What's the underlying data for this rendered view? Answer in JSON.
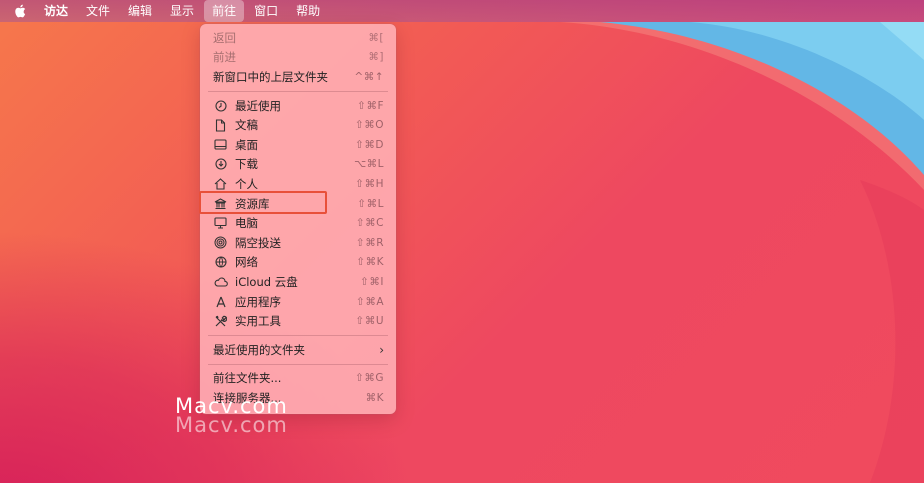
{
  "menubar": {
    "apple": "apple-logo",
    "items": [
      "访达",
      "文件",
      "编辑",
      "显示",
      "前往",
      "窗口",
      "帮助"
    ],
    "active": "前往"
  },
  "menu": {
    "nav": [
      {
        "label": "返回",
        "shortcut": "⌘[",
        "disabled": true
      },
      {
        "label": "前进",
        "shortcut": "⌘]",
        "disabled": true
      },
      {
        "label": "新窗口中的上层文件夹",
        "shortcut": "^⌘↑",
        "disabled": false
      }
    ],
    "places": [
      {
        "icon": "clock-icon",
        "label": "最近使用",
        "shortcut": "⇧⌘F"
      },
      {
        "icon": "document-icon",
        "label": "文稿",
        "shortcut": "⇧⌘O"
      },
      {
        "icon": "desktop-icon",
        "label": "桌面",
        "shortcut": "⇧⌘D"
      },
      {
        "icon": "download-icon",
        "label": "下载",
        "shortcut": "⌥⌘L"
      },
      {
        "icon": "home-icon",
        "label": "个人",
        "shortcut": "⇧⌘H"
      },
      {
        "icon": "library-icon",
        "label": "资源库",
        "shortcut": "⇧⌘L"
      },
      {
        "icon": "computer-icon",
        "label": "电脑",
        "shortcut": "⇧⌘C"
      },
      {
        "icon": "airdrop-icon",
        "label": "隔空投送",
        "shortcut": "⇧⌘R"
      },
      {
        "icon": "network-icon",
        "label": "网络",
        "shortcut": "⇧⌘K"
      },
      {
        "icon": "cloud-icon",
        "label": "iCloud 云盘",
        "shortcut": "⇧⌘I"
      },
      {
        "icon": "applications-icon",
        "label": "应用程序",
        "shortcut": "⇧⌘A"
      },
      {
        "icon": "utilities-icon",
        "label": "实用工具",
        "shortcut": "⇧⌘U"
      }
    ],
    "recent_folders": {
      "label": "最近使用的文件夹",
      "submenu_indicator": "›"
    },
    "goto": [
      {
        "label": "前往文件夹...",
        "shortcut": "⇧⌘G"
      },
      {
        "label": "连接服务器...",
        "shortcut": "⌘K"
      }
    ]
  },
  "highlighted_item": "资源库",
  "watermark": {
    "text": "Macv.com"
  },
  "colors": {
    "highlight": "#e8503a",
    "menu_bg": "#ffb0b6",
    "wallpaper_blue": "#6cc3ea"
  }
}
